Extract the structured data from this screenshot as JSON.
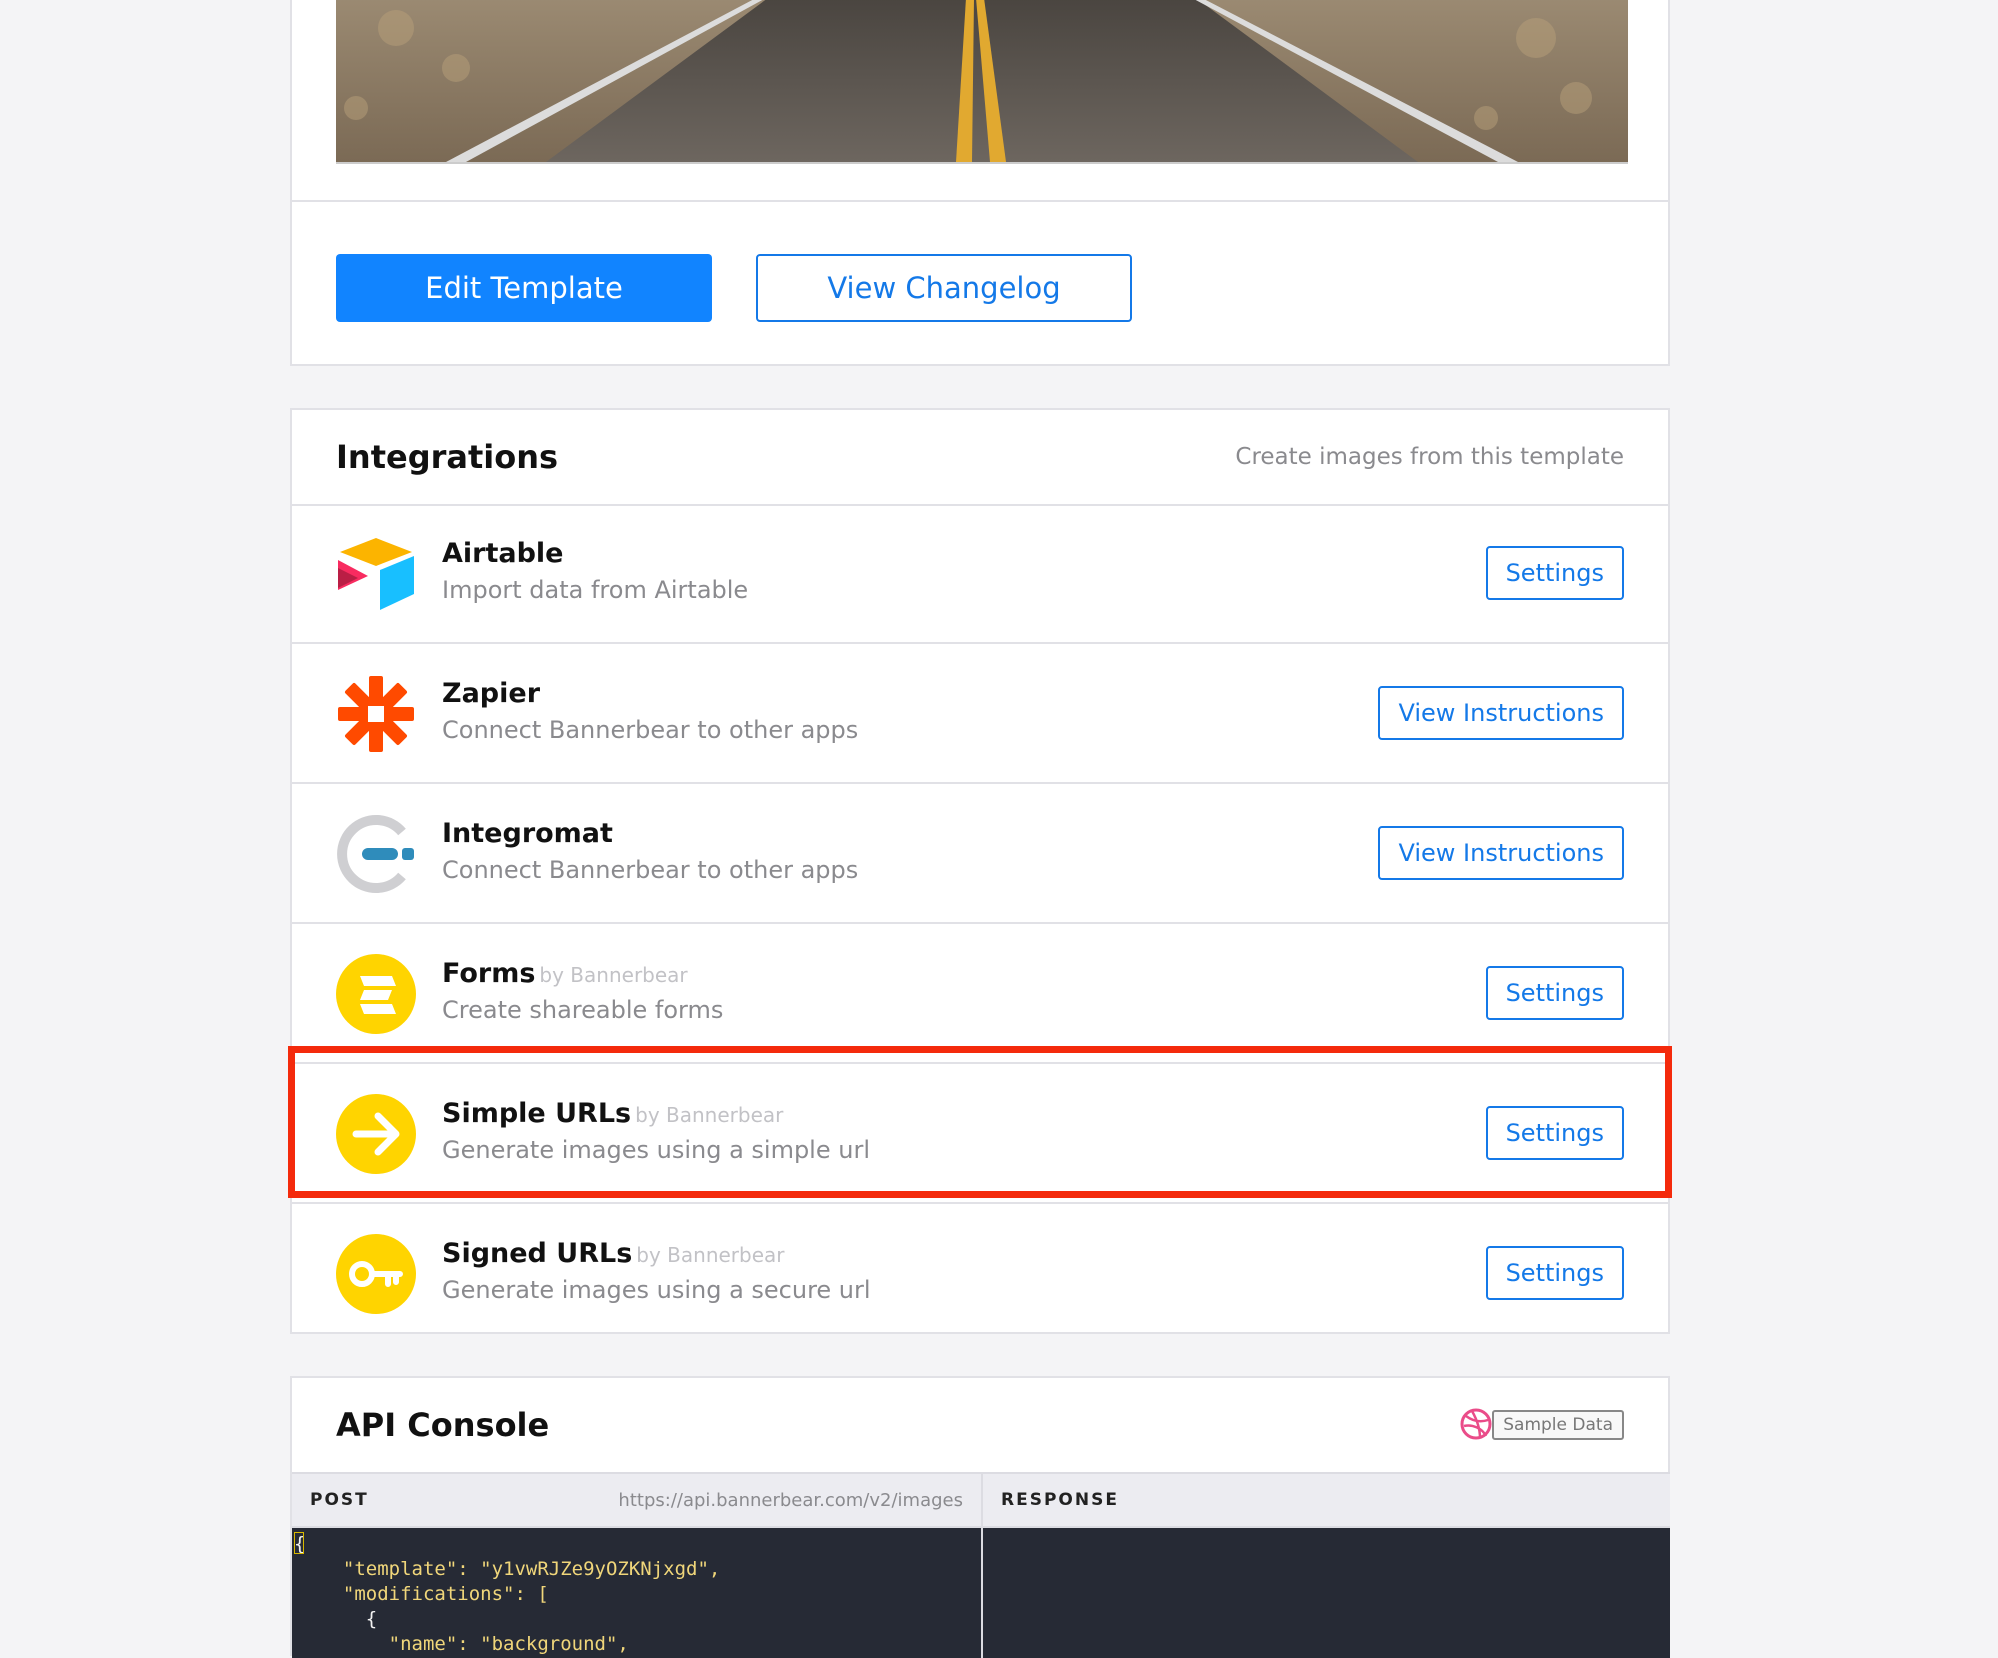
{
  "template_card": {
    "edit_button": "Edit Template",
    "changelog_button": "View Changelog"
  },
  "integrations": {
    "title": "Integrations",
    "subtitle": "Create images from this template",
    "items": [
      {
        "name": "Airtable",
        "by": "",
        "desc": "Import data from Airtable",
        "action": "Settings",
        "icon": "airtable-icon"
      },
      {
        "name": "Zapier",
        "by": "",
        "desc": "Connect Bannerbear to other apps",
        "action": "View Instructions",
        "icon": "zapier-icon"
      },
      {
        "name": "Integromat",
        "by": "",
        "desc": "Connect Bannerbear to other apps",
        "action": "View Instructions",
        "icon": "integromat-icon"
      },
      {
        "name": "Forms",
        "by": "by Bannerbear",
        "desc": "Create shareable forms",
        "action": "Settings",
        "icon": "forms-icon"
      },
      {
        "name": "Simple URLs",
        "by": "by Bannerbear",
        "desc": "Generate images using a simple url",
        "action": "Settings",
        "icon": "arrow-right-icon"
      },
      {
        "name": "Signed URLs",
        "by": "by Bannerbear",
        "desc": "Generate images using a secure url",
        "action": "Settings",
        "icon": "key-icon"
      }
    ],
    "highlight_color": "#f42a0c"
  },
  "api_console": {
    "title": "API Console",
    "sample_badge": "Sample Data",
    "post_label": "POST",
    "endpoint": "https://api.bannerbear.com/v2/images",
    "response_label": "RESPONSE",
    "code_lines": [
      "{",
      "  \"template\": \"y1vwRJZe9yOZKNjxgd\",",
      "  \"modifications\": [",
      "    {",
      "      \"name\": \"background\","
    ]
  },
  "colors": {
    "accent": "#1184ff",
    "outline": "#1479e8",
    "page_bg": "#f4f4f6"
  }
}
